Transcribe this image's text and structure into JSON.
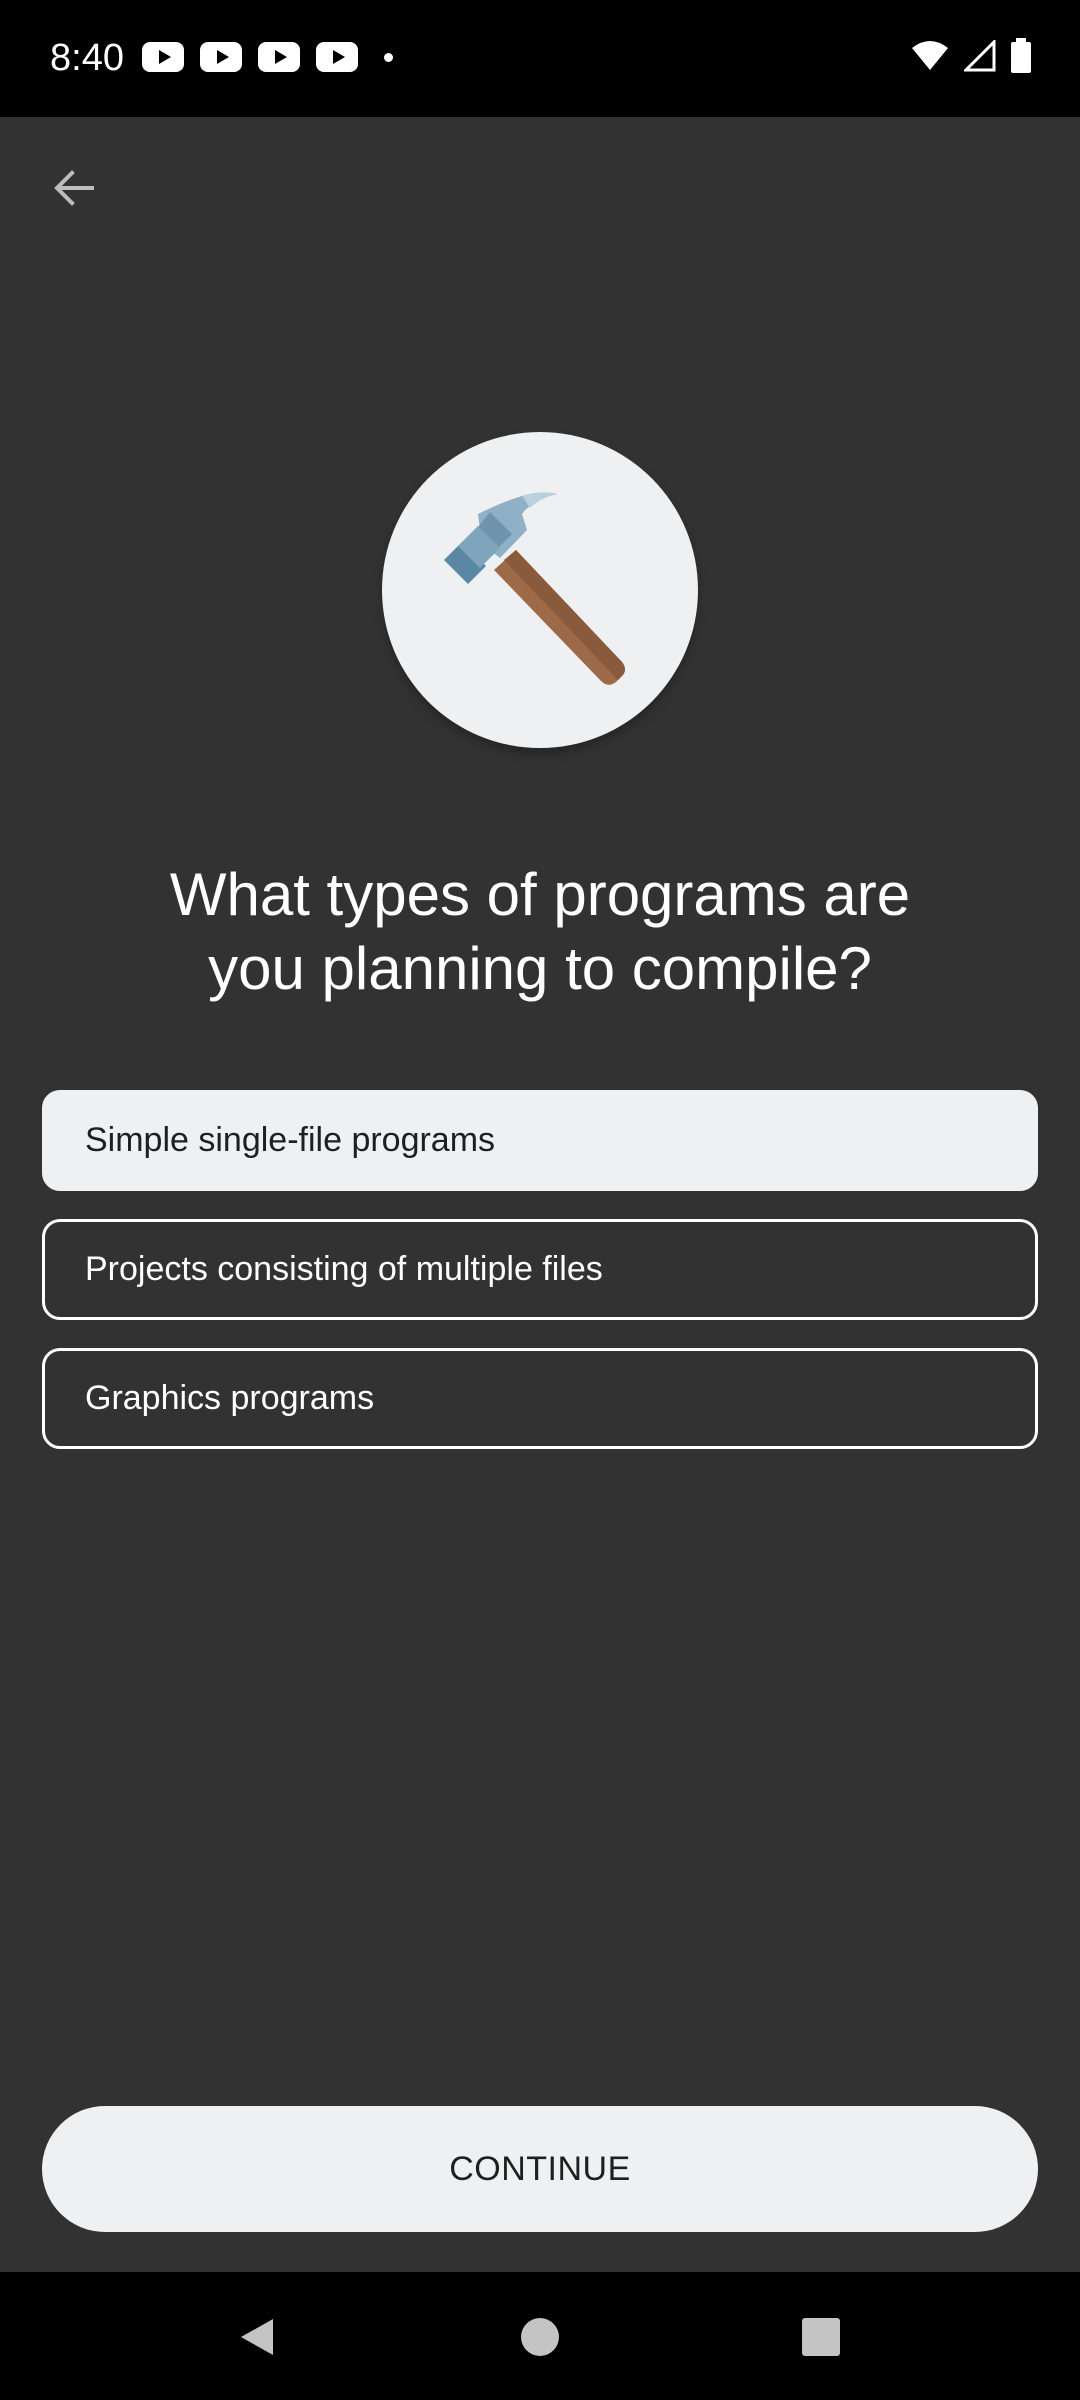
{
  "status_bar": {
    "time": "8:40",
    "notifications": [
      "youtube-icon",
      "youtube-icon",
      "youtube-icon",
      "youtube-icon",
      "dot-icon"
    ],
    "system_icons": [
      "wifi-icon",
      "signal-icon",
      "battery-icon"
    ]
  },
  "header": {
    "back_icon": "arrow-left-icon"
  },
  "hero": {
    "icon": "hammer-icon",
    "circle_color": "#eff0f2"
  },
  "question": {
    "line1": "What types of programs are",
    "line2": "you planning to compile?"
  },
  "options": [
    {
      "label": "Simple single-file programs",
      "selected": true
    },
    {
      "label": "Projects consisting of multiple files",
      "selected": false
    },
    {
      "label": "Graphics programs",
      "selected": false
    }
  ],
  "continue_label": "CONTINUE",
  "nav_bar": {
    "items": [
      "back-triangle-icon",
      "home-circle-icon",
      "recents-square-icon"
    ]
  },
  "colors": {
    "background": "#323232",
    "accent_light": "#eff0f2",
    "text_light": "#ffffff",
    "text_dark": "#1f1f1f"
  }
}
